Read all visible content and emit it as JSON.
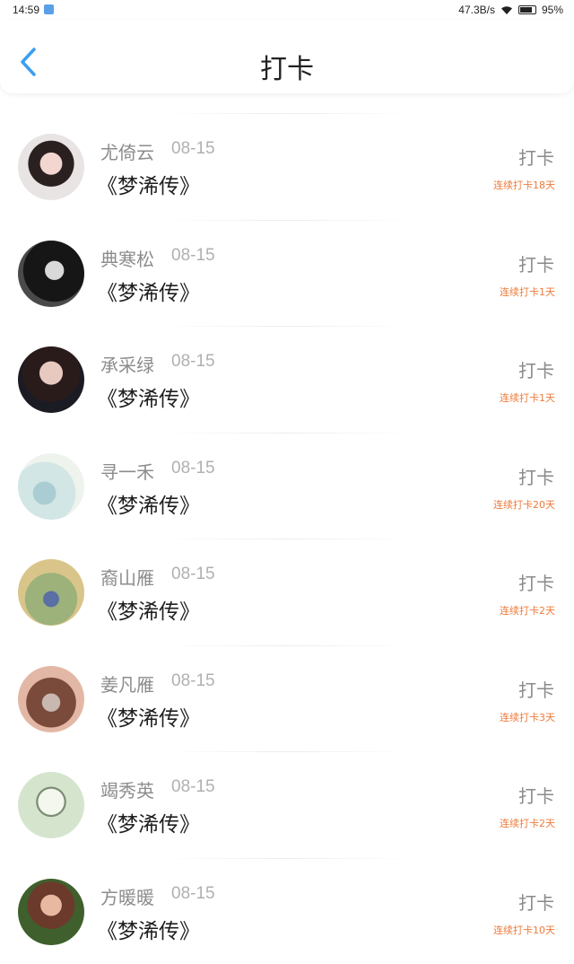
{
  "status_bar": {
    "time": "14:59",
    "network_speed": "47.3B/s",
    "battery": "95%"
  },
  "header": {
    "title": "打卡",
    "back_icon": "chevron-left-icon",
    "accent_color": "#3a9ff0"
  },
  "colors": {
    "streak": "#ee7a3a",
    "name": "#8c8c8c",
    "date": "#b0b0b0"
  },
  "items": [
    {
      "name": "尤倚云",
      "date": "08-15",
      "book": "《梦浠传》",
      "action": "打卡",
      "streak": "连续打卡18天"
    },
    {
      "name": "典寒松",
      "date": "08-15",
      "book": "《梦浠传》",
      "action": "打卡",
      "streak": "连续打卡1天"
    },
    {
      "name": "承采绿",
      "date": "08-15",
      "book": "《梦浠传》",
      "action": "打卡",
      "streak": "连续打卡1天"
    },
    {
      "name": "寻一禾",
      "date": "08-15",
      "book": "《梦浠传》",
      "action": "打卡",
      "streak": "连续打卡20天"
    },
    {
      "name": "裔山雁",
      "date": "08-15",
      "book": "《梦浠传》",
      "action": "打卡",
      "streak": "连续打卡2天"
    },
    {
      "name": "姜凡雁",
      "date": "08-15",
      "book": "《梦浠传》",
      "action": "打卡",
      "streak": "连续打卡3天"
    },
    {
      "name": "竭秀英",
      "date": "08-15",
      "book": "《梦浠传》",
      "action": "打卡",
      "streak": "连续打卡2天"
    },
    {
      "name": "方暖暖",
      "date": "08-15",
      "book": "《梦浠传》",
      "action": "打卡",
      "streak": "连续打卡10天"
    }
  ]
}
